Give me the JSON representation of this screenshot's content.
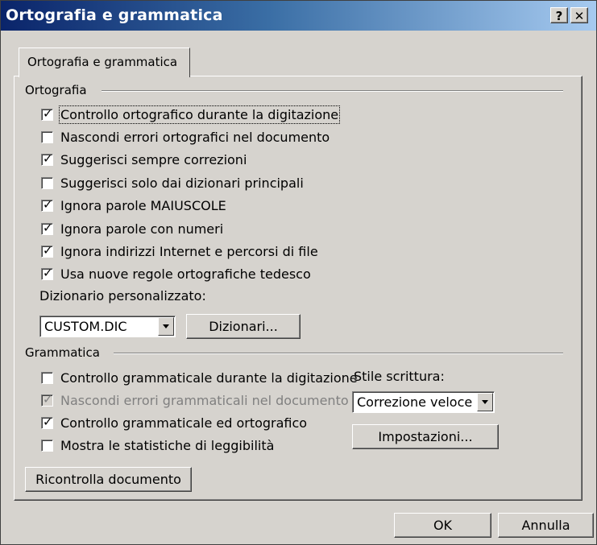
{
  "window": {
    "title": "Ortografia e grammatica",
    "help_label": "?",
    "close_label": "✕"
  },
  "tab": {
    "label": "Ortografia e grammatica"
  },
  "spelling": {
    "title": "Ortografia",
    "options": [
      {
        "label": "Controllo ortografico durante la digitazione",
        "checked": true
      },
      {
        "label": "Nascondi errori ortografici nel documento",
        "checked": false
      },
      {
        "label": "Suggerisci sempre correzioni",
        "checked": true
      },
      {
        "label": "Suggerisci solo dai dizionari principali",
        "checked": false
      },
      {
        "label": "Ignora parole MAIUSCOLE",
        "checked": true
      },
      {
        "label": "Ignora parole con numeri",
        "checked": true
      },
      {
        "label": "Ignora indirizzi Internet e percorsi di file",
        "checked": true
      },
      {
        "label": "Usa nuove regole ortografiche tedesco",
        "checked": true
      }
    ],
    "custom_dictionary_label": "Dizionario personalizzato:",
    "custom_dictionary_value": "CUSTOM.DIC",
    "dictionaries_button": "Dizionari..."
  },
  "grammar": {
    "title": "Grammatica",
    "options": [
      {
        "label": "Controllo grammaticale durante la digitazione",
        "checked": false
      },
      {
        "label": "Nascondi errori grammaticali nel documento",
        "checked": true,
        "disabled": true
      },
      {
        "label": "Controllo grammaticale ed ortografico",
        "checked": true
      },
      {
        "label": "Mostra le statistiche di leggibilità",
        "checked": false
      }
    ],
    "style_label": "Stile scrittura:",
    "style_value": "Correzione veloce",
    "settings_button": "Impostazioni...",
    "recheck_button": "Ricontrolla documento"
  },
  "footer": {
    "ok_label": "OK",
    "cancel_label": "Annulla"
  }
}
